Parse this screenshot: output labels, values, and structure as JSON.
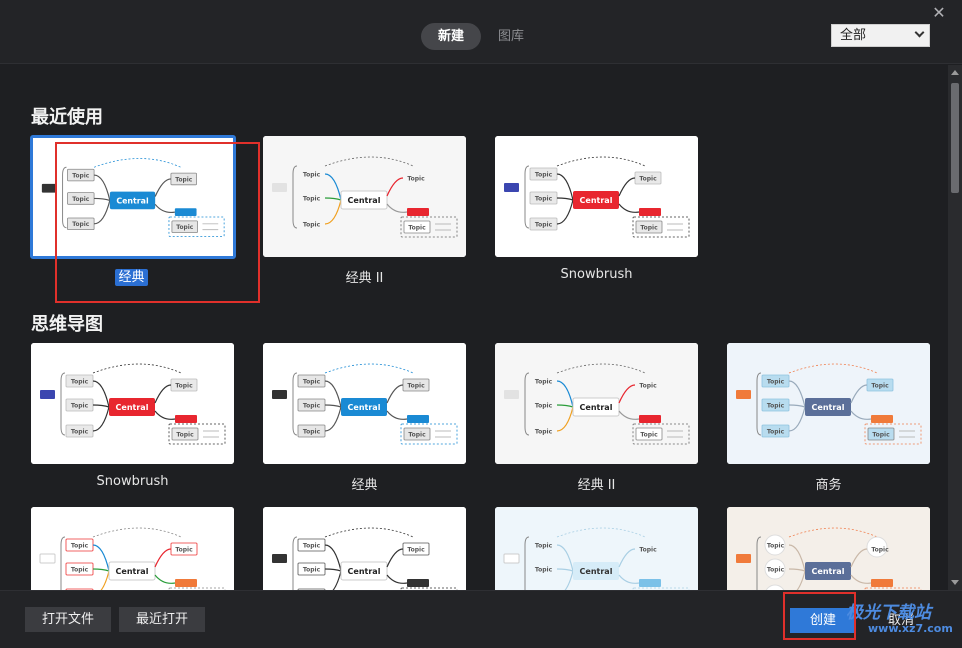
{
  "tabs": {
    "new": "新建",
    "gallery": "图库"
  },
  "filter": {
    "selected": "全部"
  },
  "sections": [
    {
      "title": "最近使用",
      "cards": [
        {
          "label": "经典",
          "style": "classic",
          "selected": true
        },
        {
          "label": "经典 II",
          "style": "classic2",
          "selected": false
        },
        {
          "label": "Snowbrush",
          "style": "snowbrush",
          "selected": false
        }
      ]
    },
    {
      "title": "思维导图",
      "cards": [
        {
          "label": "Snowbrush",
          "style": "snowbrush"
        },
        {
          "label": "经典",
          "style": "classic"
        },
        {
          "label": "经典 II",
          "style": "classic2"
        },
        {
          "label": "商务",
          "style": "business"
        },
        {
          "label": "",
          "style": "colorful"
        },
        {
          "label": "",
          "style": "mono"
        },
        {
          "label": "",
          "style": "lightblue"
        },
        {
          "label": "",
          "style": "beige"
        }
      ]
    }
  ],
  "preview_text": {
    "topic": "Topic",
    "central": "Central"
  },
  "bottom": {
    "open_file": "打开文件",
    "recent_open": "最近打开",
    "create": "创建",
    "cancel": "取消"
  },
  "watermark": {
    "brand": "极光下载站",
    "url": "www.xz7.com"
  },
  "colors": {
    "accent": "#2f79d8",
    "annotation": "#e0302b",
    "classic_central": "#1a8ad4",
    "snowbrush_central": "#e8262f",
    "business_central": "#5b6f99"
  },
  "icons": {
    "close": "close-icon",
    "dropdown": "chevron-down-icon"
  }
}
